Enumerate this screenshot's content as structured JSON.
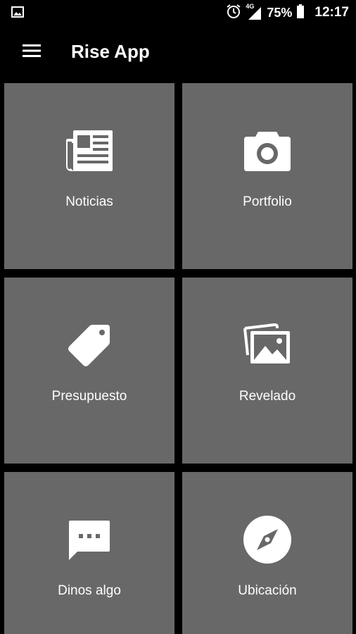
{
  "status_bar": {
    "battery": "75%",
    "time": "12:17",
    "network": "4G",
    "icons": [
      "image-notification-icon",
      "alarm-icon",
      "signal-icon",
      "battery-icon"
    ]
  },
  "app_bar": {
    "title": "Rise App",
    "menu_icon": "hamburger-menu-icon"
  },
  "tiles": [
    {
      "label": "Noticias",
      "icon": "newspaper-icon"
    },
    {
      "label": "Portfolio",
      "icon": "camera-icon"
    },
    {
      "label": "Presupuesto",
      "icon": "tag-icon"
    },
    {
      "label": "Revelado",
      "icon": "photos-icon"
    },
    {
      "label": "Dinos algo",
      "icon": "chat-bubble-icon"
    },
    {
      "label": "Ubicación",
      "icon": "compass-icon"
    }
  ],
  "colors": {
    "background": "#000000",
    "tile": "#686868",
    "text": "#ffffff"
  }
}
